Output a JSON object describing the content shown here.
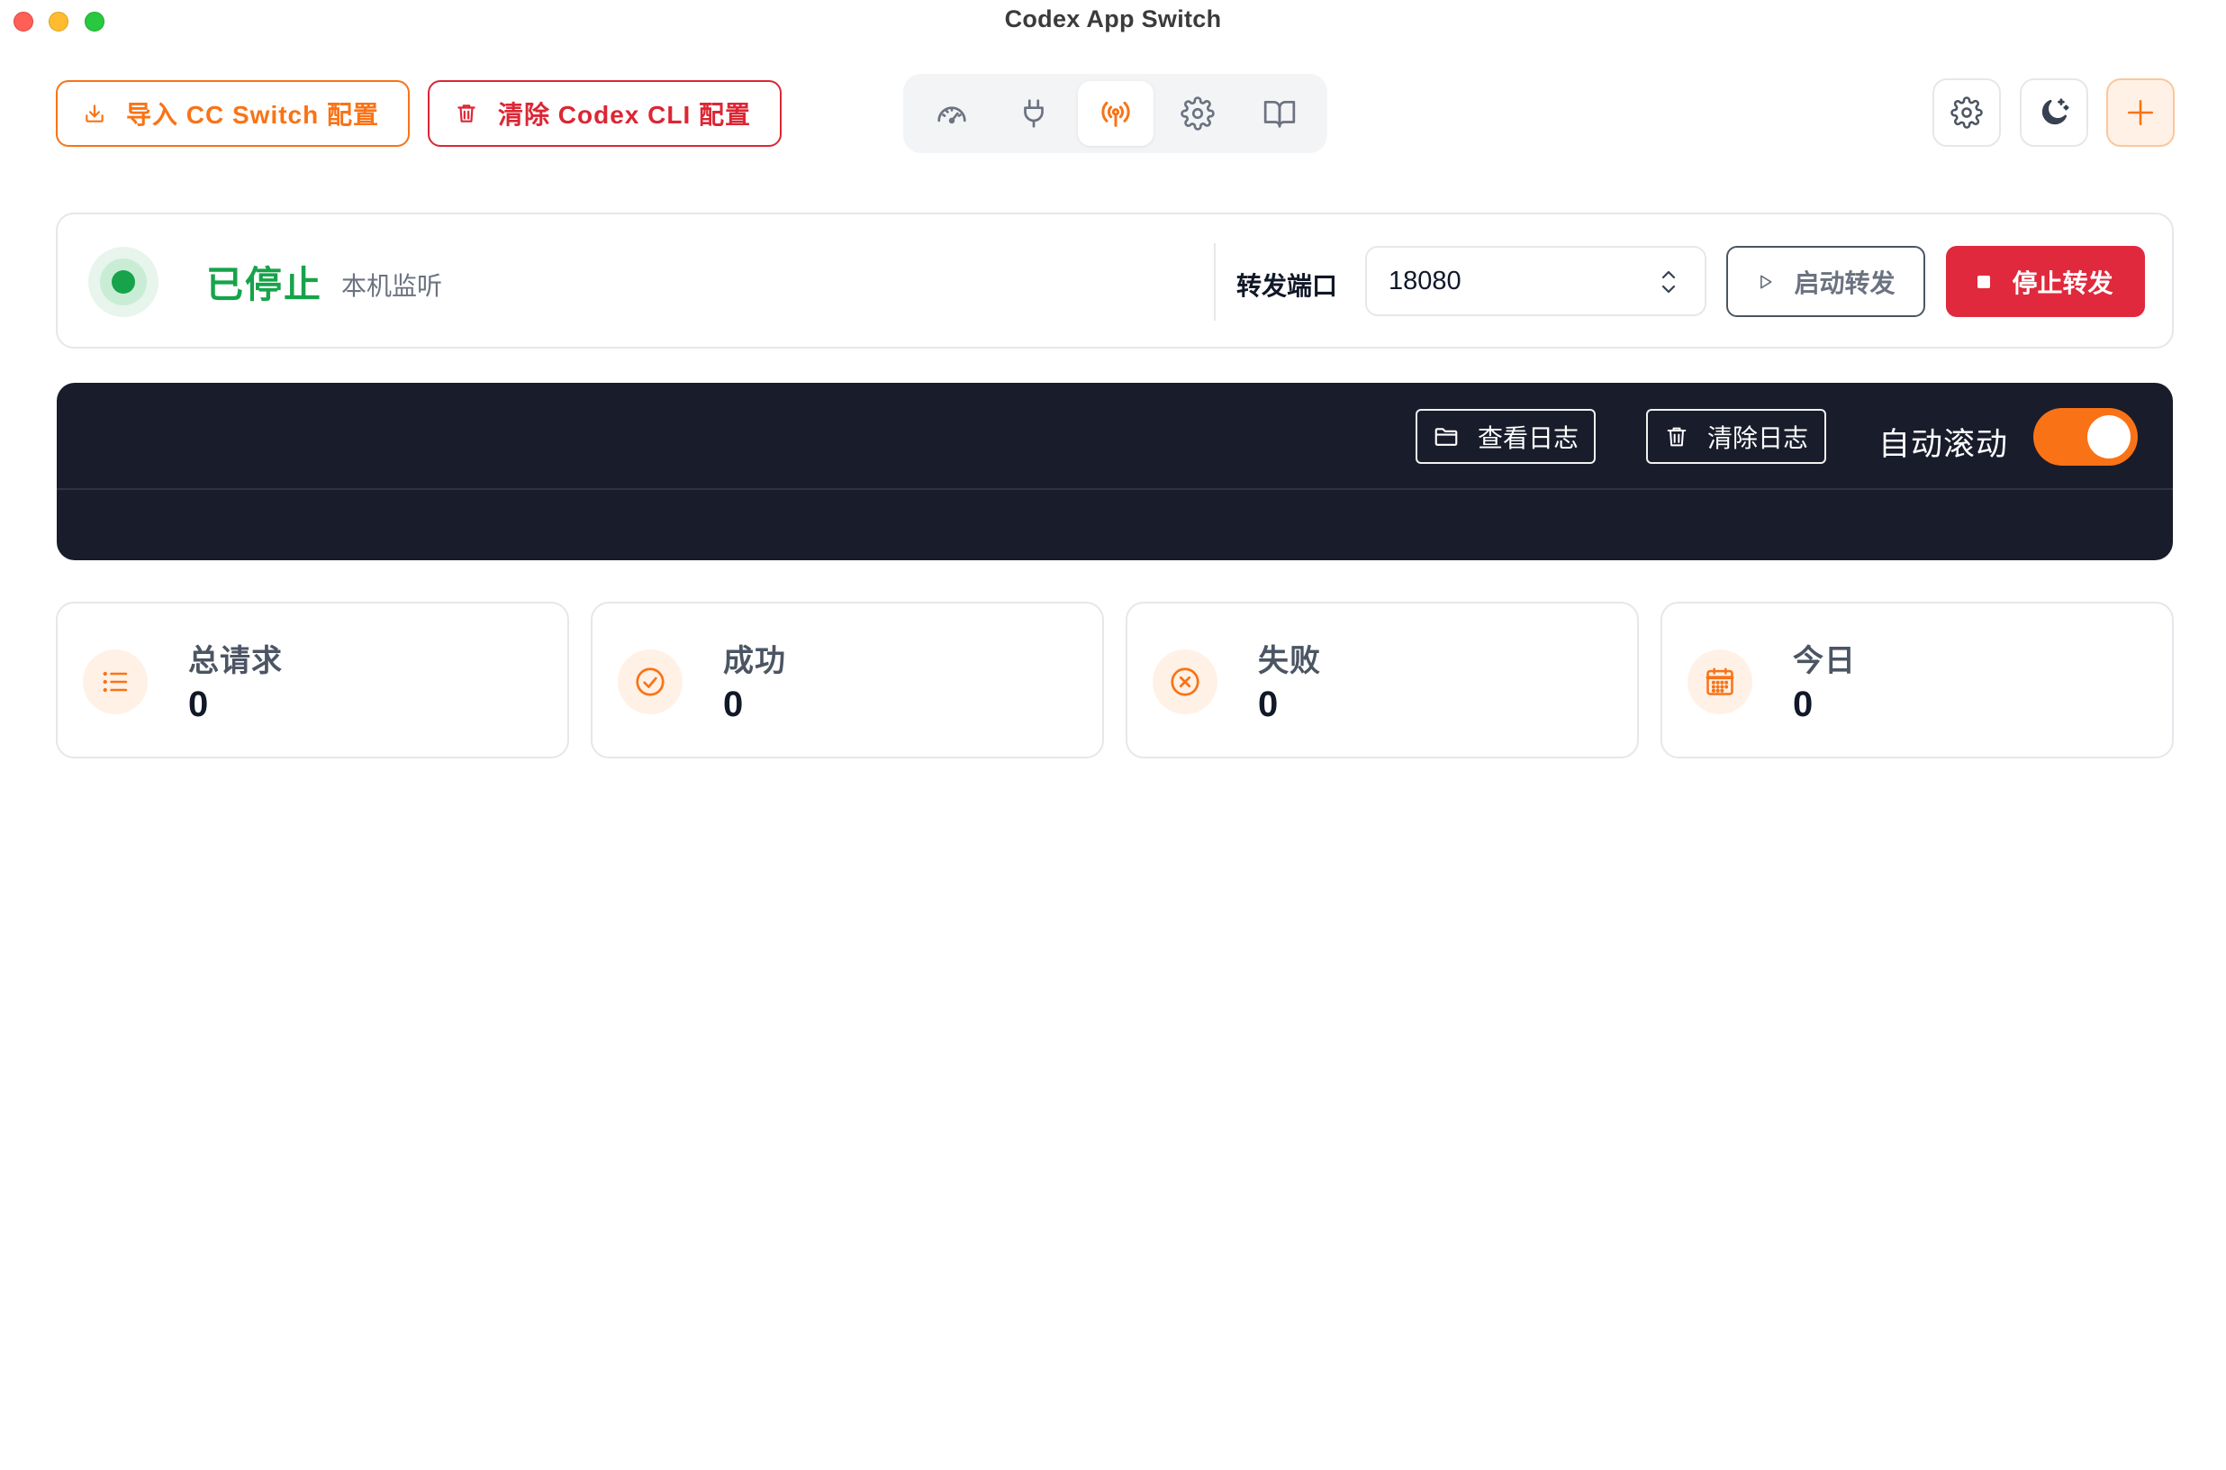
{
  "window": {
    "title": "Codex App Switch"
  },
  "toolbar": {
    "import_label": "导入 CC Switch 配置",
    "clear_cli_label": "清除 Codex CLI 配置",
    "accent_color": "#f97316",
    "danger_color": "#dc2634"
  },
  "nav": {
    "tabs": [
      {
        "icon": "dashboard-icon",
        "active": false
      },
      {
        "icon": "plug-icon",
        "active": false
      },
      {
        "icon": "broadcast-icon",
        "active": true
      },
      {
        "icon": "gear-icon",
        "active": false
      },
      {
        "icon": "book-icon",
        "active": false
      }
    ]
  },
  "status": {
    "state": "已停止",
    "subtitle": "本机监听",
    "color": "#16a34a",
    "port_label": "转发端口",
    "port_value": "18080",
    "start_label": "启动转发",
    "stop_label": "停止转发"
  },
  "log": {
    "view_label": "查看日志",
    "clear_label": "清除日志",
    "auto_scroll_label": "自动滚动",
    "auto_scroll_on": true
  },
  "stats": [
    {
      "label": "总请求",
      "value": "0",
      "icon": "list-icon"
    },
    {
      "label": "成功",
      "value": "0",
      "icon": "check-circle-icon"
    },
    {
      "label": "失败",
      "value": "0",
      "icon": "x-circle-icon"
    },
    {
      "label": "今日",
      "value": "0",
      "icon": "calendar-icon"
    }
  ]
}
